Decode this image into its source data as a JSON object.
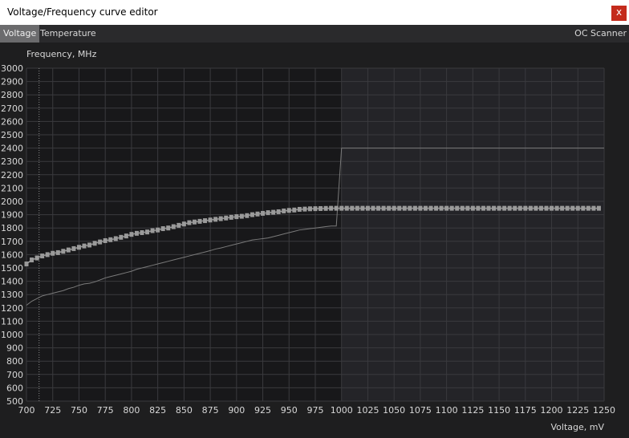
{
  "window": {
    "title": "Voltage/Frequency curve editor",
    "close_label": "x"
  },
  "tabs": [
    {
      "label": "Voltage",
      "active": true
    },
    {
      "label": "Temperature",
      "active": false
    }
  ],
  "right_tab": {
    "label": "OC Scanner"
  },
  "colors": {
    "background": "#1e1e1f",
    "plot_left": "#18181a",
    "plot_right": "#242428",
    "grid": "#3a3a3e",
    "axis_text": "#d8d8d8",
    "curve_marker": "#9a9a9a",
    "reference_line": "#7a7a7a"
  },
  "chart_data": {
    "type": "line",
    "ylabel": "Frequency, MHz",
    "xlabel": "Voltage, mV",
    "xlim": [
      700,
      1250
    ],
    "ylim": [
      500,
      3000
    ],
    "x_ticks": [
      700,
      725,
      750,
      775,
      800,
      825,
      850,
      875,
      900,
      925,
      950,
      975,
      1000,
      1025,
      1050,
      1075,
      1100,
      1125,
      1150,
      1175,
      1200,
      1225,
      1250
    ],
    "y_ticks": [
      500,
      600,
      700,
      800,
      900,
      1000,
      1100,
      1200,
      1300,
      1400,
      1500,
      1600,
      1700,
      1800,
      1900,
      2000,
      2100,
      2200,
      2300,
      2400,
      2500,
      2600,
      2700,
      2800,
      2900,
      3000
    ],
    "grid": true,
    "shaded_region_from_x": 1000,
    "dotted_marker_x": 712,
    "series": [
      {
        "style": "markers",
        "x": [
          700,
          705,
          710,
          715,
          720,
          725,
          730,
          735,
          740,
          745,
          750,
          755,
          760,
          765,
          770,
          775,
          780,
          785,
          790,
          795,
          800,
          805,
          810,
          815,
          820,
          825,
          830,
          835,
          840,
          845,
          850,
          855,
          860,
          865,
          870,
          875,
          880,
          885,
          890,
          895,
          900,
          905,
          910,
          915,
          920,
          925,
          930,
          935,
          940,
          945,
          950,
          955,
          960,
          965,
          970,
          975,
          980,
          985,
          990,
          995,
          1000,
          1005,
          1010,
          1015,
          1020,
          1025,
          1030,
          1035,
          1040,
          1045,
          1050,
          1055,
          1060,
          1065,
          1070,
          1075,
          1080,
          1085,
          1090,
          1095,
          1100,
          1105,
          1110,
          1115,
          1120,
          1125,
          1130,
          1135,
          1140,
          1145,
          1150,
          1155,
          1160,
          1165,
          1170,
          1175,
          1180,
          1185,
          1190,
          1195,
          1200,
          1205,
          1210,
          1215,
          1220,
          1225,
          1230,
          1235,
          1240,
          1245
        ],
        "y": [
          1530,
          1560,
          1575,
          1590,
          1600,
          1610,
          1615,
          1625,
          1635,
          1645,
          1655,
          1665,
          1672,
          1685,
          1695,
          1705,
          1712,
          1720,
          1730,
          1740,
          1752,
          1760,
          1765,
          1770,
          1780,
          1785,
          1795,
          1800,
          1810,
          1820,
          1830,
          1840,
          1845,
          1850,
          1855,
          1860,
          1865,
          1870,
          1875,
          1880,
          1885,
          1888,
          1893,
          1900,
          1905,
          1910,
          1915,
          1918,
          1922,
          1928,
          1932,
          1935,
          1940,
          1942,
          1944,
          1945,
          1946,
          1947,
          1948,
          1948,
          1948,
          1948,
          1948,
          1948,
          1948,
          1948,
          1948,
          1948,
          1948,
          1948,
          1948,
          1948,
          1948,
          1948,
          1948,
          1948,
          1948,
          1948,
          1948,
          1948,
          1948,
          1948,
          1948,
          1948,
          1948,
          1948,
          1948,
          1948,
          1948,
          1948,
          1948,
          1948,
          1948,
          1948,
          1948,
          1948,
          1948,
          1948,
          1948,
          1948,
          1948,
          1948,
          1948,
          1948,
          1948,
          1948,
          1948,
          1948,
          1948,
          1948
        ]
      },
      {
        "style": "line",
        "x": [
          700,
          705,
          710,
          715,
          720,
          725,
          730,
          735,
          740,
          745,
          750,
          755,
          760,
          765,
          770,
          775,
          780,
          785,
          790,
          795,
          800,
          805,
          810,
          815,
          820,
          825,
          830,
          835,
          840,
          845,
          850,
          855,
          860,
          865,
          870,
          875,
          880,
          885,
          890,
          895,
          900,
          905,
          910,
          915,
          920,
          925,
          930,
          935,
          940,
          945,
          950,
          955,
          960,
          965,
          970,
          975,
          980,
          985,
          990,
          995,
          1000,
          1010,
          1050,
          1100,
          1150,
          1200,
          1250
        ],
        "y": [
          1220,
          1250,
          1270,
          1290,
          1300,
          1310,
          1320,
          1330,
          1345,
          1355,
          1370,
          1380,
          1385,
          1395,
          1410,
          1425,
          1435,
          1445,
          1455,
          1465,
          1475,
          1490,
          1500,
          1510,
          1520,
          1530,
          1540,
          1550,
          1560,
          1570,
          1580,
          1590,
          1600,
          1610,
          1620,
          1630,
          1642,
          1650,
          1660,
          1670,
          1680,
          1690,
          1700,
          1710,
          1715,
          1720,
          1725,
          1735,
          1745,
          1755,
          1765,
          1775,
          1785,
          1790,
          1795,
          1800,
          1805,
          1810,
          1815,
          1815,
          2400,
          2400,
          2400,
          2400,
          2400,
          2400,
          2400
        ]
      }
    ]
  }
}
